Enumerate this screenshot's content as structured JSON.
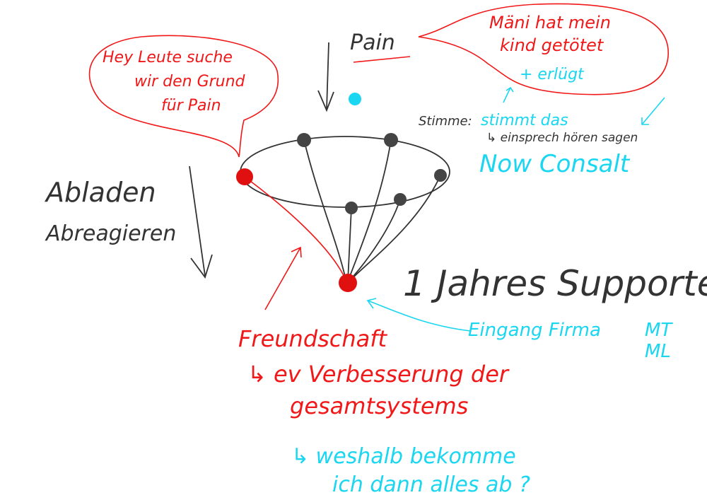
{
  "colors": {
    "red": "#f01818",
    "cyan": "#1ad6f0",
    "dark": "#333333"
  },
  "bubble_left": {
    "lines": [
      "Hey Leute suche",
      "wir den Grund",
      "für Pain"
    ]
  },
  "pain_label": "Pain",
  "bubble_right": {
    "lines": [
      "Mäni hat mein",
      "kind getötet"
    ],
    "addition": "+ erlügt"
  },
  "stimme": {
    "label": "Stimme:",
    "text": "stimmt das",
    "note": "↳ einsprech hören sagen"
  },
  "now_consalt": "Now Consalt",
  "left_labels": [
    "Abladen",
    "Abreagieren"
  ],
  "support": "1 Jahres Supporte",
  "eingang": {
    "text": "Eingang Firma",
    "codes": [
      "MT",
      "ML"
    ]
  },
  "freundschaft": {
    "title": "Freundschaft",
    "lines": [
      "↳ ev Verbesserung der",
      "gesamtsystems"
    ]
  },
  "question": {
    "lines": [
      "↳ weshalb bekomme",
      "ich dann alles ab ?"
    ]
  }
}
